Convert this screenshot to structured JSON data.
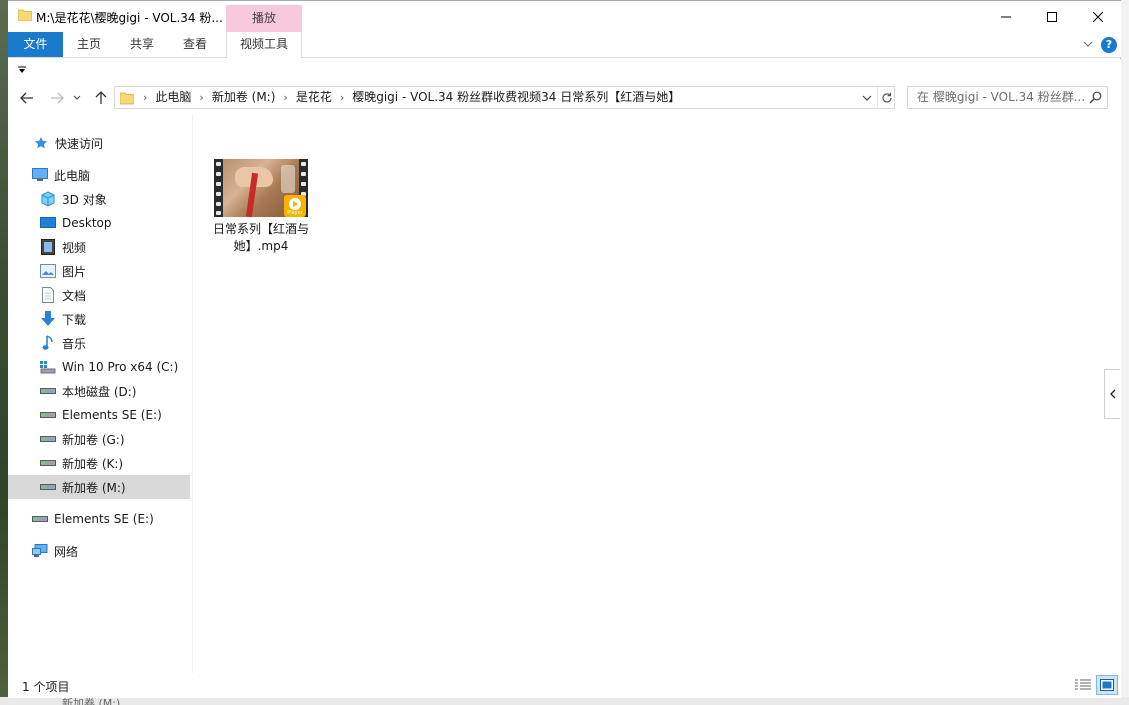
{
  "window": {
    "title": "M:\\是花花\\樱晚gigi - VOL.34 粉...",
    "contextual_tab_group": "播放"
  },
  "ribbon": {
    "tabs": [
      "文件",
      "主页",
      "共享",
      "查看",
      "视频工具"
    ]
  },
  "address": {
    "crumbs": [
      "此电脑",
      "新加卷 (M:)",
      "是花花",
      "樱晚gigi - VOL.34 粉丝群收费视频34 日常系列【红酒与她】"
    ]
  },
  "search": {
    "placeholder": "在 樱晚gigi - VOL.34 粉丝群..."
  },
  "sidebar": {
    "quick_access": "快速访问",
    "this_pc": "此电脑",
    "items": [
      {
        "label": "3D 对象",
        "icon": "cube-icon"
      },
      {
        "label": "Desktop",
        "icon": "desktop-icon"
      },
      {
        "label": "视频",
        "icon": "video-icon"
      },
      {
        "label": "图片",
        "icon": "pictures-icon"
      },
      {
        "label": "文档",
        "icon": "documents-icon"
      },
      {
        "label": "下载",
        "icon": "download-icon"
      },
      {
        "label": "音乐",
        "icon": "music-icon"
      },
      {
        "label": "Win 10 Pro x64 (C:)",
        "icon": "system-drive-icon"
      },
      {
        "label": "本地磁盘 (D:)",
        "icon": "drive-icon"
      },
      {
        "label": "Elements SE (E:)",
        "icon": "drive-icon"
      },
      {
        "label": "新加卷 (G:)",
        "icon": "drive-icon"
      },
      {
        "label": "新加卷 (K:)",
        "icon": "drive-icon"
      },
      {
        "label": "新加卷 (M:)",
        "icon": "drive-icon"
      }
    ],
    "external_drive": "Elements SE (E:)",
    "network": "网络"
  },
  "files": [
    {
      "name": "日常系列【红酒与她】.mp4",
      "badge": "Player"
    }
  ],
  "status": {
    "item_count": "1 个项目"
  },
  "desktop": {
    "ghost_label": "新加卷 (M:)"
  },
  "colors": {
    "accent": "#1979ca",
    "contextual_tab": "#f8c8dc",
    "selection": "#d9d9d9",
    "folder": "#f8d775"
  }
}
